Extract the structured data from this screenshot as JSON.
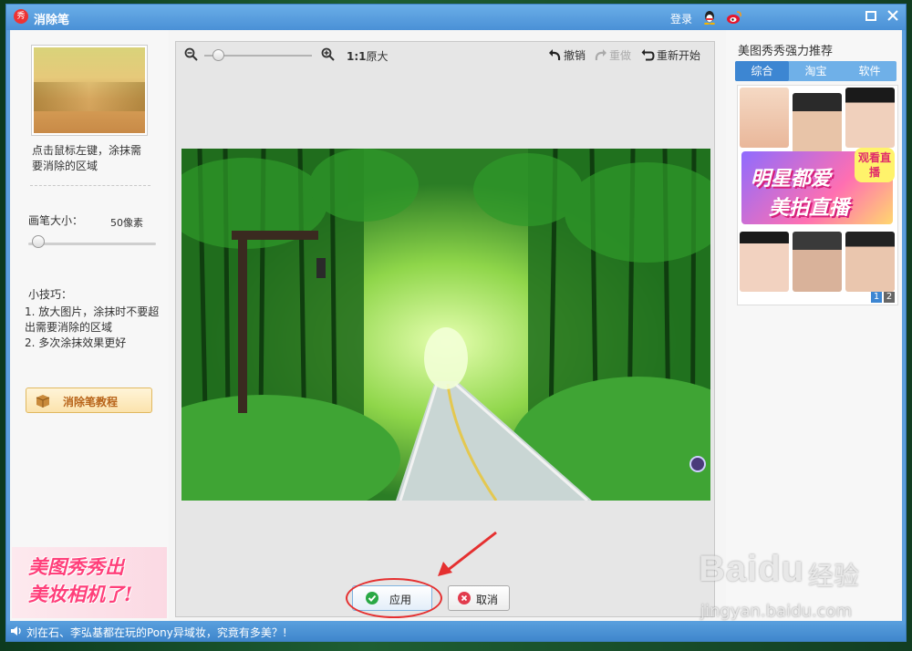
{
  "window": {
    "logo_text": "秀",
    "title": "消除笔",
    "login_label": "登录",
    "icons": [
      "qq-icon",
      "weibo-icon",
      "maximize-icon",
      "close-icon"
    ]
  },
  "left_panel": {
    "hint": "点击鼠标左键，涂抹需要消除的区域",
    "brush_size_label": "画笔大小：",
    "brush_size_value": "50像素",
    "brush_size_fraction": 0.05,
    "tips_title": "小技巧：",
    "tips": [
      "1. 放大图片，涂抹时不要超出需要消除的区域",
      "2. 多次涂抹效果更好"
    ],
    "tutorial_button": "消除笔教程",
    "ad_line1": "美图秀秀出",
    "ad_line2": "美妆相机了!"
  },
  "toolbar": {
    "zoom_level_fraction": 0.08,
    "ratio_bold": "1:1",
    "ratio_label": "原大",
    "undo_label": "撤销",
    "redo_label": "重做",
    "restart_label": "重新开始"
  },
  "actions": {
    "apply_label": "应用",
    "cancel_label": "取消"
  },
  "right_panel": {
    "title": "美图秀秀强力推荐",
    "tabs": [
      "综合",
      "淘宝",
      "软件"
    ],
    "active_tab": "综合",
    "ad_line1": "明星都爱",
    "ad_line2": "美拍直播",
    "live_badge": "观看直播",
    "pages": [
      "1",
      "2"
    ]
  },
  "status_bar": {
    "news": "刘在石、李弘基都在玩的Pony异域妆，究竟有多美？!"
  },
  "watermark": {
    "brand": "Baidu",
    "brand_cn": "经验",
    "url": "jingyan.baidu.com"
  },
  "colors": {
    "titlebar": "#4a90d6",
    "accent": "#3d86d2",
    "highlight_ring": "#e53030"
  }
}
